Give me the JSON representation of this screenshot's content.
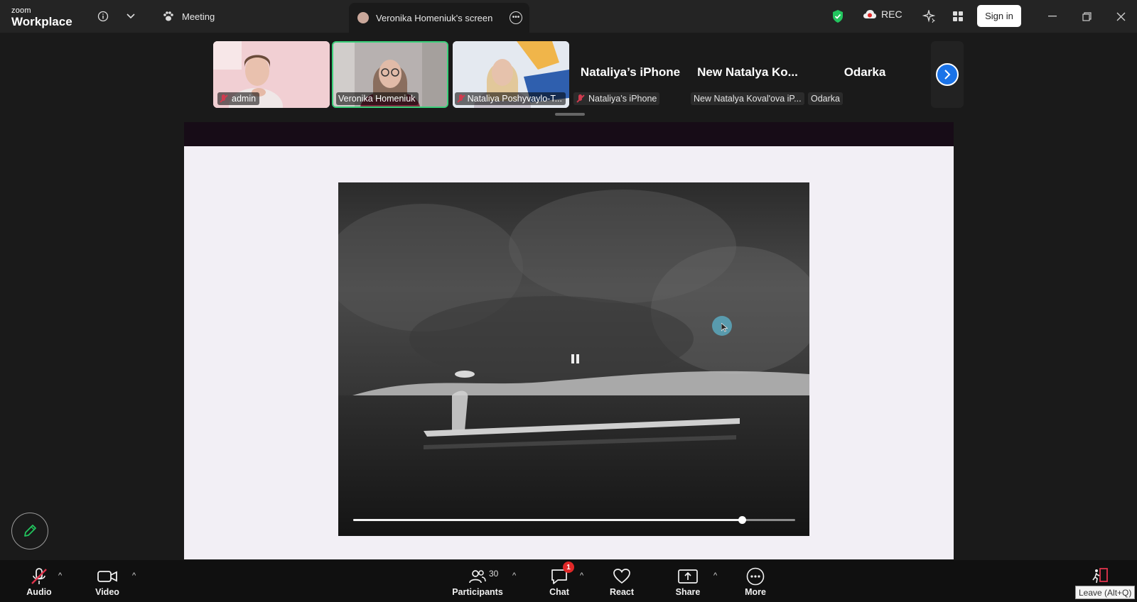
{
  "app": {
    "logo_small": "zoom",
    "logo_big": "Workplace"
  },
  "topbar": {
    "meeting_label": "Meeting",
    "screen_tab_label": "Veronika Homeniuk's screen",
    "rec_label": "REC",
    "signin_label": "Sign in"
  },
  "participants_strip": [
    {
      "name": "admin",
      "muted": true,
      "has_video": true
    },
    {
      "name": "Veronika Homeniuk",
      "muted": false,
      "has_video": true,
      "active_speaker": true
    },
    {
      "name": "Nataliya Poshyvaylo-T...",
      "muted": true,
      "has_video": true
    },
    {
      "display_name": "Nataliya’s iPhone",
      "name": "Nataliya’s iPhone",
      "muted": true,
      "has_video": false
    },
    {
      "display_name": "New  Natalya  Ko...",
      "name": "New Natalya Koval'ova iP...",
      "muted": false,
      "has_video": false
    },
    {
      "display_name": "Odarka",
      "name": "Odarka",
      "muted": false,
      "has_video": false
    }
  ],
  "video_player": {
    "state": "playing",
    "progress_fraction": 0.88
  },
  "toolbar": {
    "audio_label": "Audio",
    "video_label": "Video",
    "participants_label": "Participants",
    "participants_count": "30",
    "chat_label": "Chat",
    "chat_badge": "1",
    "react_label": "React",
    "share_label": "Share",
    "more_label": "More",
    "leave_tooltip": "Leave (Alt+Q)"
  },
  "colors": {
    "topbar_bg": "#242424",
    "accent_green": "#22c55e",
    "active_border": "#3ad07a",
    "mute_red": "#d13b4f",
    "next_blue": "#1a73e8",
    "badge_red": "#e02828"
  }
}
